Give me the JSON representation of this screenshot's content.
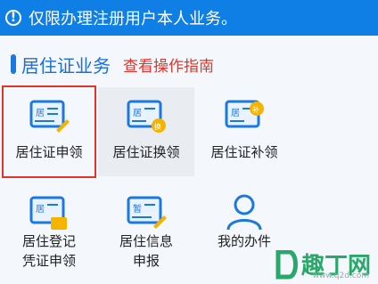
{
  "notice": {
    "text": "仅限办理注册用户本人业务。"
  },
  "section": {
    "title": "居住证业务",
    "guide_link": "查看操作指南"
  },
  "services": [
    {
      "label": "居住证申领",
      "icon": "id-card-pen-icon",
      "selected": true
    },
    {
      "label": "居住证换领",
      "icon": "id-card-exchange-icon",
      "selected": false
    },
    {
      "label": "居住证补领",
      "icon": "id-card-reissue-icon",
      "selected": false
    },
    {
      "label": "居住登记凭证申领",
      "icon": "id-card-register-icon",
      "selected": false
    },
    {
      "label": "居住信息申报",
      "icon": "temporary-card-pen-icon",
      "selected": false
    },
    {
      "label": "我的办件",
      "icon": "user-profile-icon",
      "selected": false
    }
  ],
  "watermark": {
    "text": "趣丁网",
    "url": "www.q2d.com"
  },
  "colors": {
    "primary": "#0f7fe6",
    "accent_red": "#e0352b",
    "icon_gold": "#f5b400"
  }
}
